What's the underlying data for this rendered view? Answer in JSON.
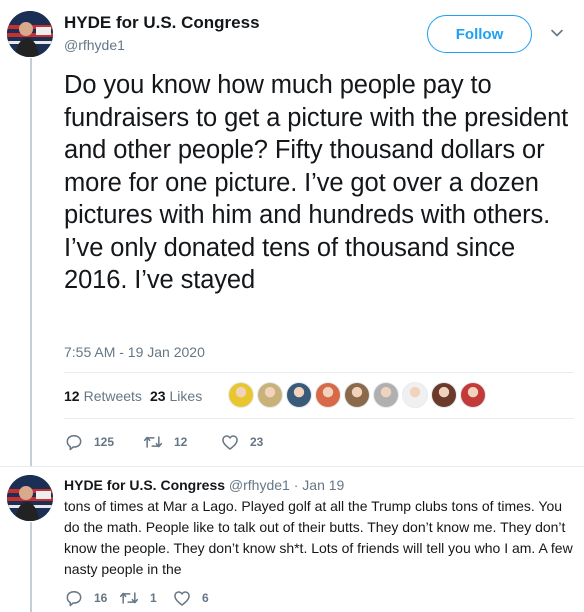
{
  "main_tweet": {
    "author_name": "HYDE for U.S. Congress",
    "author_handle": "@rfhyde1",
    "follow_label": "Follow",
    "text": "Do you know how much people pay to fundraisers to get a picture with the president and other people? Fifty thousand dollars or more for one picture. I’ve got over a dozen pictures with him and hundreds with others. I’ve only donated tens of thousand since 2016. I’ve stayed",
    "timestamp": "7:55 AM - 19 Jan 2020",
    "stats": {
      "retweets_count": "12",
      "retweets_label": "Retweets",
      "likes_count": "23",
      "likes_label": "Likes"
    },
    "likers": [
      "#e8c630",
      "#c9b27a",
      "#3a5a7a",
      "#d86a4a",
      "#8a6a4a",
      "#b0b0b0",
      "#f0f0f0",
      "#6a3a2a",
      "#c23a3a"
    ],
    "actions": {
      "replies": "125",
      "retweets": "12",
      "likes": "23"
    }
  },
  "reply_tweet": {
    "author_name": "HYDE for U.S. Congress",
    "author_handle": "@rfhyde1",
    "date": "Jan 19",
    "text": "tons of times at Mar a Lago. Played golf at all the Trump clubs tons of times. You do the math. People like to talk out of their butts. They don’t know me. They don’t know the people. They don’t know sh*t. Lots of friends will tell you who I am. A few nasty people in the",
    "actions": {
      "replies": "16",
      "retweets": "1",
      "likes": "6"
    }
  },
  "colors": {
    "accent": "#1da1f2",
    "secondary_text": "#657786",
    "thread_line": "#c4cfd6"
  }
}
